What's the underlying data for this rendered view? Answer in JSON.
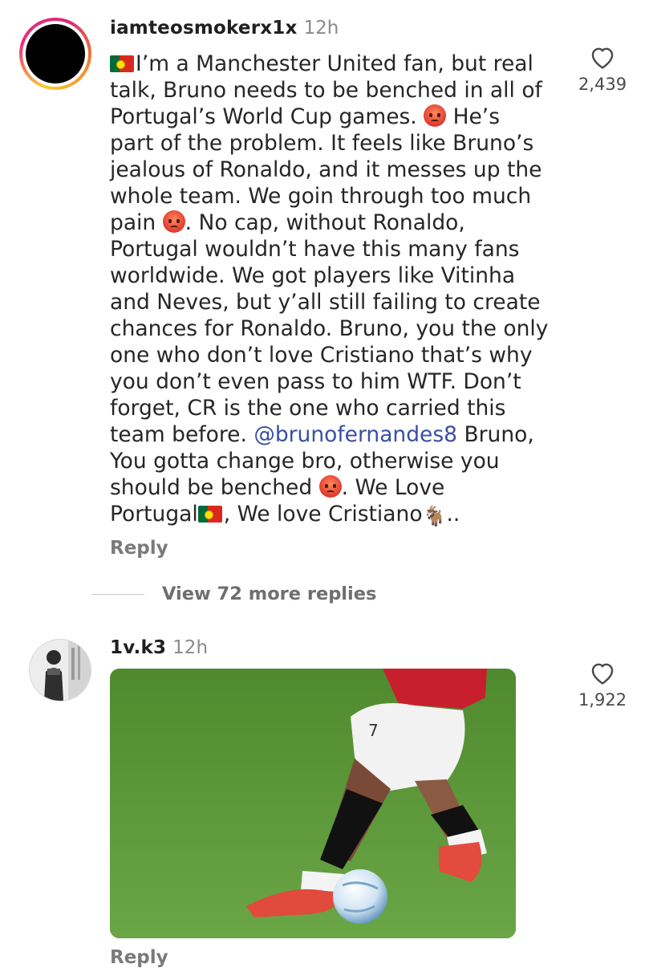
{
  "comments": [
    {
      "username": "iamteosmokerx1x",
      "time": "12h",
      "lines": [
        "I’m a Manchester United fan, but real",
        "talk, Bruno needs to be benched in all of",
        "Portugal’s World Cup games. ",
        " He’s",
        "part of the problem. It feels like Bruno’s",
        "jealous of Ronaldo, and it messes up the",
        "whole team. We goin through too much",
        "pain ",
        ". No cap, without Ronaldo,",
        "Portugal wouldn’t have this many fans",
        "worldwide. We got players like Vitinha",
        "and Neves, but y’all still failing to create",
        "chances for Ronaldo. Bruno, you the only",
        "one who don’t love Cristiano that’s why",
        "you don’t even pass to him WTF. Don’t",
        "forget, CR is the one who carried this",
        "team before. ",
        "@brunofernandes8",
        " Bruno,",
        "You gotta change bro, otherwise you",
        "should be benched ",
        ". We Love",
        "Portugal",
        ", We love Cristiano",
        ".."
      ],
      "emoji": {
        "flag": "portugal-flag",
        "angry": "angry-face",
        "goat": "🐐"
      },
      "reply_label": "Reply",
      "like_count": "2,439",
      "view_replies_label": "View 72 more replies"
    },
    {
      "username": "1v.k3",
      "time": "12h",
      "media": "gif-football-player-kicking-ball",
      "reply_label": "Reply",
      "like_count": "1,922"
    }
  ],
  "colors": {
    "mention": "#3a4fa3",
    "meta_gray": "#8a8a8a",
    "reply_gray": "#7a7a7a",
    "grass": "#5b8f3a"
  }
}
